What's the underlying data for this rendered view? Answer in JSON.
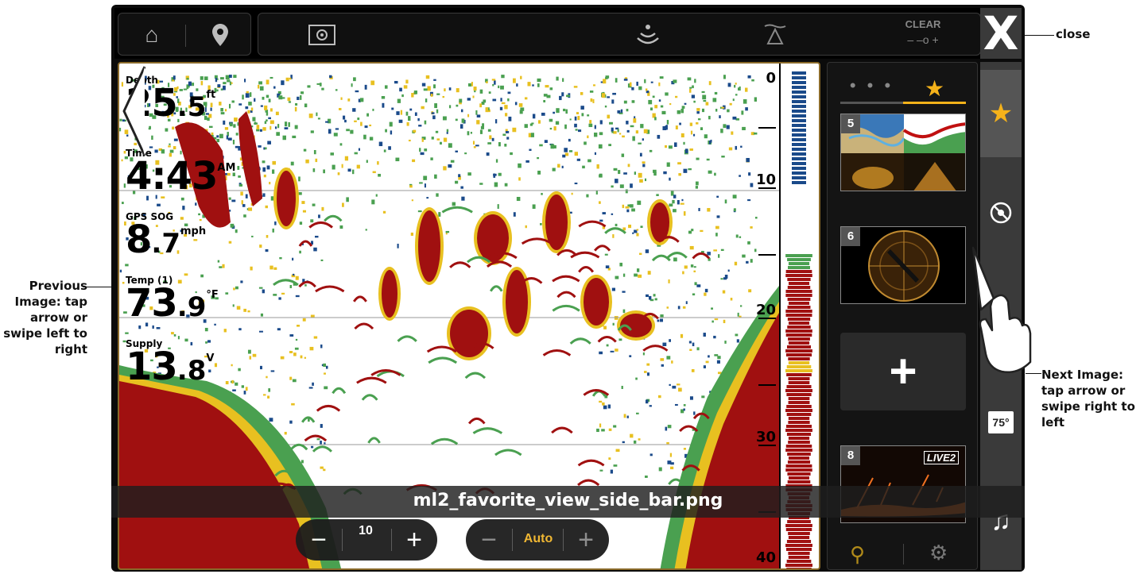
{
  "callouts": {
    "previous": "Previous Image: tap arrow or swipe left to right",
    "next": "Next Image: tap arrow or swipe right to left",
    "close": "close"
  },
  "topbar": {
    "icons": [
      "home-icon",
      "waypoint-icon",
      "sonar-settings-icon",
      "sonar-icon",
      "water-clarity-icon"
    ],
    "clear_label": "CLEAR",
    "clear_scale": "– –o +",
    "close_glyph": "X"
  },
  "readouts": [
    {
      "label": "Depth",
      "value": "25",
      "decimal": ".5",
      "unit": "ft"
    },
    {
      "label": "Time",
      "value": "4:43",
      "decimal": "",
      "unit": "AM"
    },
    {
      "label": "GPS SOG",
      "value": "8",
      "decimal": ".7",
      "unit": "mph"
    },
    {
      "label": "Temp (1)",
      "value": "73",
      "decimal": ".9",
      "unit": "°F"
    },
    {
      "label": "Supply",
      "value": "13",
      "decimal": ".8",
      "unit": "V"
    }
  ],
  "depth_scale": [
    "0",
    "10",
    "20",
    "30",
    "40"
  ],
  "controls": {
    "range_minus": "−",
    "range_value": "10",
    "range_plus": "+",
    "sens_minus": "−",
    "sens_value": "Auto",
    "sens_plus": "+"
  },
  "filename": "ml2_favorite_view_side_bar.png",
  "favorites": {
    "tab_dots": "• • •",
    "tab_star": "★",
    "cards": [
      {
        "num": "5"
      },
      {
        "num": "6"
      },
      {
        "num": "8",
        "badge": "LIVE2"
      }
    ],
    "add_label": "+"
  },
  "rail": {
    "temp_badge": "75°",
    "items": [
      "star-icon",
      "sonar-cone-icon",
      "temp-icon",
      "music-icon"
    ]
  },
  "colors": {
    "accent": "#f5b21a",
    "sonar_red": "#a01010",
    "sonar_yellow": "#e8c020",
    "sonar_green": "#4aa050",
    "sonar_blue": "#1a4a8a"
  }
}
